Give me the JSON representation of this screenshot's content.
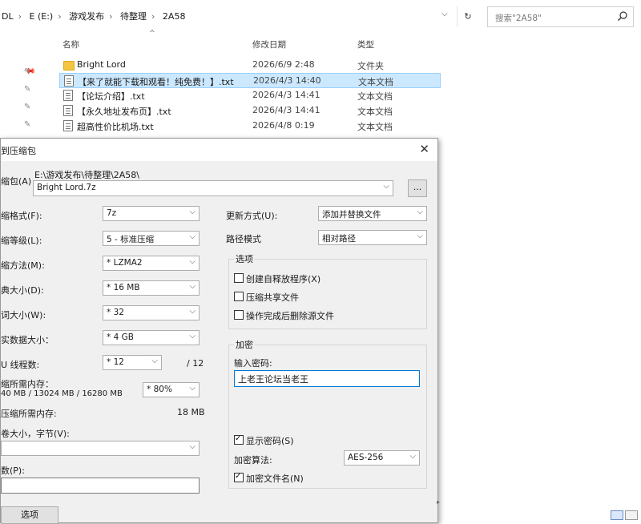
{
  "explorer": {
    "breadcrumbs": [
      "DL",
      "E (E:)",
      "游戏发布",
      "待整理",
      "2A58"
    ],
    "search_placeholder": "搜索\"2A58\"",
    "columns": {
      "name": "名称",
      "date": "修改日期",
      "type": "类型"
    },
    "files": [
      {
        "name": "Bright Lord",
        "date": "2026/6/9 2:48",
        "type": "文件夹",
        "icon": "folder-icon",
        "selected": false
      },
      {
        "name": "【来了就能下载和观看！纯免费！】.txt",
        "date": "2026/4/3 14:40",
        "type": "文本文档",
        "icon": "text-file-icon",
        "selected": true
      },
      {
        "name": "【论坛介绍】.txt",
        "date": "2026/4/3 14:41",
        "type": "文本文档",
        "icon": "text-file-icon",
        "selected": false
      },
      {
        "name": "【永久地址发布页】.txt",
        "date": "2026/4/3 14:41",
        "type": "文本文档",
        "icon": "text-file-icon",
        "selected": false
      },
      {
        "name": "超高性价比机场.txt",
        "date": "2026/4/8 0:19",
        "type": "文本文档",
        "icon": "text-file-icon",
        "selected": false
      }
    ]
  },
  "dialog": {
    "title": "到压缩包",
    "close_label": "✕",
    "archive_label": "缩包(A)",
    "archive_path": "E:\\游戏发布\\待整理\\2A58\\",
    "archive_name": "Bright Lord.7z",
    "browse_label": "...",
    "format_label": "缩格式(F):",
    "format_value": "7z",
    "level_label": "缩等级(L):",
    "level_value": "5 - 标准压缩",
    "method_label": "缩方法(M):",
    "method_value": "* LZMA2",
    "dict_label": "典大小(D):",
    "dict_value": "* 16 MB",
    "word_label": "词大小(W):",
    "word_value": "* 32",
    "solid_label": "实数据大小：",
    "solid_value": "* 4 GB",
    "threads_label": "U 线程数:",
    "threads_value": "* 12",
    "threads_total": "/ 12",
    "mem_label": "缩所需内存：",
    "mem_value": "40 MB / 13024 MB / 16280 MB",
    "mem_percent": "* 80%",
    "decomp_mem_label": "压缩所需内存:",
    "decomp_mem_value": "18 MB",
    "split_label": "卷大小，字节(V):",
    "params_label": "数(P):",
    "options_button": "选项",
    "update_label": "更新方式(U):",
    "update_value": "添加并替换文件",
    "path_label": "路径模式",
    "path_value": "相对路径",
    "options_group": "选项",
    "opt_sfx": "创建自释放程序(X)",
    "opt_shared": "压缩共享文件",
    "opt_delete": "操作完成后删除源文件",
    "encrypt_group": "加密",
    "password_label": "输入密码:",
    "password_value": "上老王论坛当老王",
    "show_password": "显示密码(S)",
    "enc_method_label": "加密算法:",
    "enc_method_value": "AES-256",
    "encrypt_names": "加密文件名(N)"
  }
}
